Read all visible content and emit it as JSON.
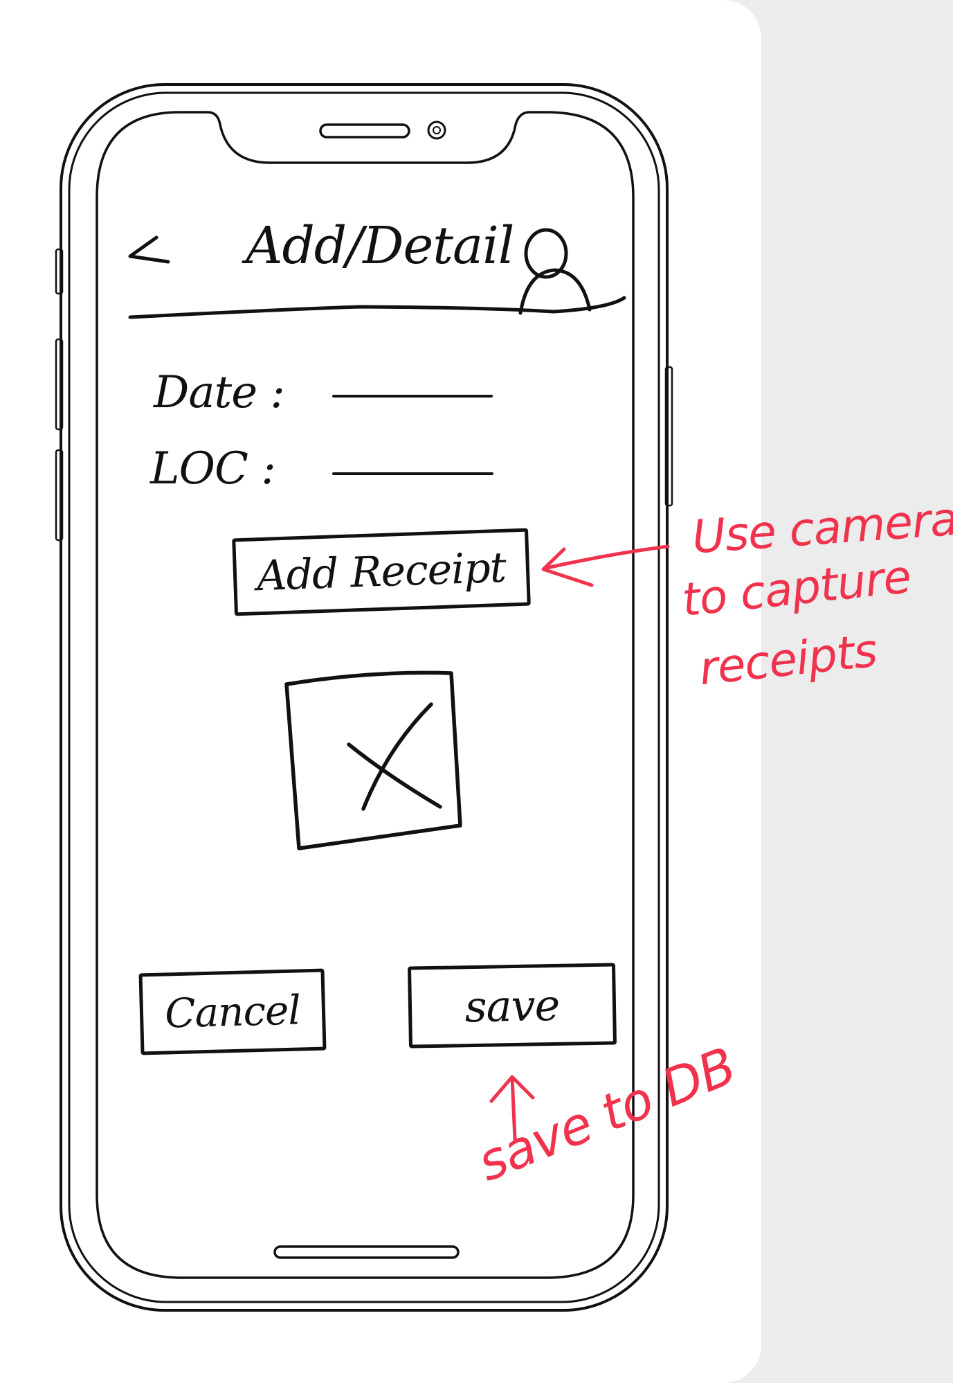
{
  "header": {
    "title": "Add/Detail"
  },
  "form": {
    "date_label": "Date :",
    "loc_label": "LOC :",
    "date_value": "",
    "loc_value": ""
  },
  "buttons": {
    "add_receipt": "Add Receipt",
    "cancel": "Cancel",
    "save": "save"
  },
  "annotations": {
    "camera_note": [
      "Use camera",
      "to capture",
      "receipts"
    ],
    "save_note": "save to DB"
  },
  "colors": {
    "ink": "#111111",
    "annotation": "#f0324d"
  }
}
